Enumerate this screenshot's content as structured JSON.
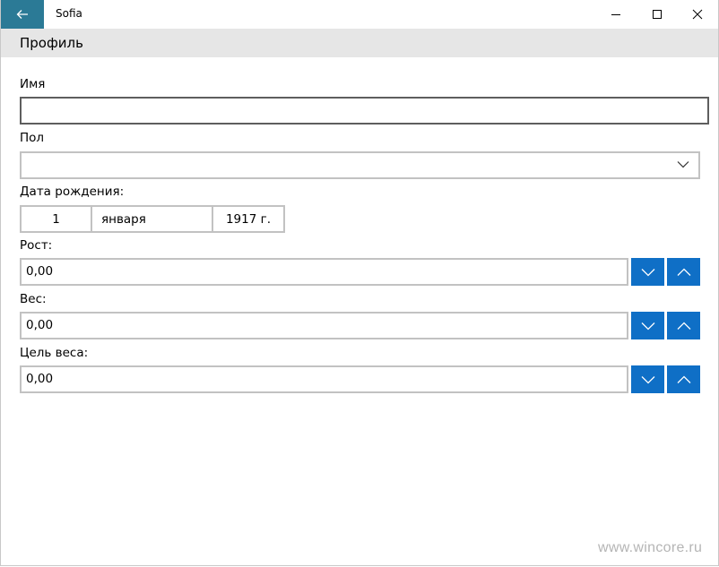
{
  "window": {
    "app_title": "Sofia",
    "accent_color": "#2b7a96",
    "icons": {
      "back": "back-arrow-icon",
      "minimize": "minimize-icon",
      "maximize": "maximize-icon",
      "close": "close-icon"
    }
  },
  "page": {
    "title": "Профиль"
  },
  "form": {
    "name": {
      "label": "Имя",
      "value": "",
      "placeholder": ""
    },
    "gender": {
      "label": "Пол",
      "selected": ""
    },
    "birthdate": {
      "label": "Дата рождения:",
      "day": "1",
      "month": "января",
      "year": "1917 г."
    },
    "height": {
      "label": "Рост:",
      "value": "0,00"
    },
    "weight": {
      "label": "Вес:",
      "value": "0,00"
    },
    "target_weight": {
      "label": "Цель веса:",
      "value": "0,00"
    },
    "spin_button_color": "#0f6fc6"
  },
  "watermark": "www.wincore.ru"
}
